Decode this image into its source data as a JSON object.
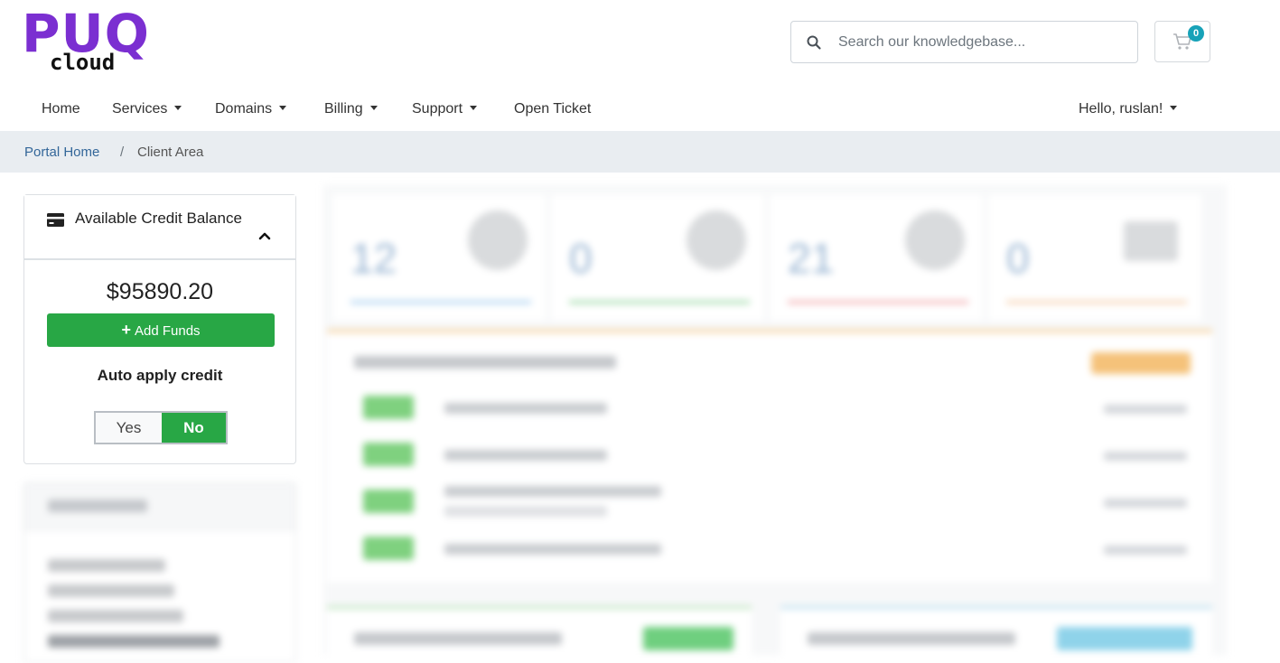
{
  "brand": {
    "logo_word": "PUQ",
    "logo_sub": "cloud",
    "accent_color": "#7b2fd1"
  },
  "search": {
    "placeholder": "Search our knowledgebase..."
  },
  "cart": {
    "icon": "cart-icon",
    "count": "0"
  },
  "nav": {
    "items": [
      {
        "label": "Home",
        "has_caret": false
      },
      {
        "label": "Services",
        "has_caret": true
      },
      {
        "label": "Domains",
        "has_caret": true
      },
      {
        "label": "Billing",
        "has_caret": true
      },
      {
        "label": "Support",
        "has_caret": true
      },
      {
        "label": "Open Ticket",
        "has_caret": false
      }
    ],
    "user_greeting": "Hello, ruslan!"
  },
  "breadcrumb": {
    "home": "Portal Home",
    "separator": "/",
    "current": "Client Area"
  },
  "credit_panel": {
    "title": "Available Credit Balance",
    "balance": "$95890.20",
    "add_funds_label": "Add Funds",
    "auto_apply_label": "Auto apply credit",
    "toggle_yes": "Yes",
    "toggle_no": "No",
    "toggle_selected": "No",
    "button_color": "#28a745"
  }
}
